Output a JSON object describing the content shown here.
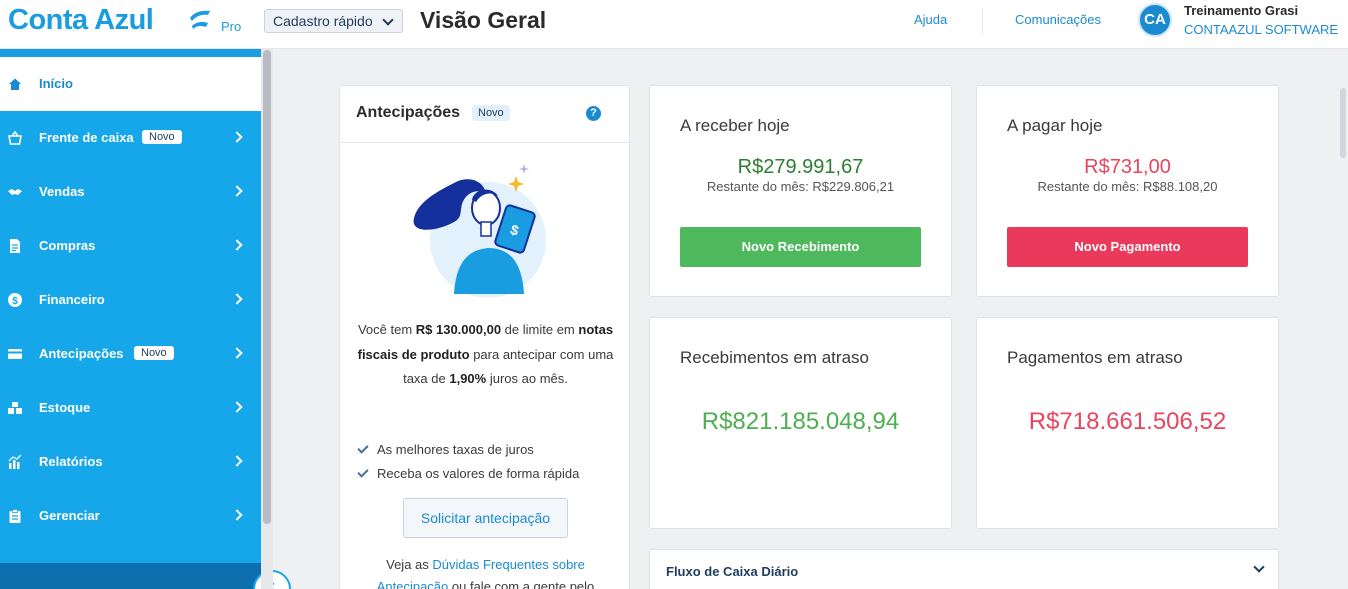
{
  "header": {
    "logo": "Conta Azul",
    "plan": "Pro",
    "quick_register": "Cadastro rápido",
    "page_title": "Visão Geral",
    "help": "Ajuda",
    "communications": "Comunicações",
    "avatar_initials": "CA",
    "user_name": "Treinamento Grasi",
    "company": "CONTAAZUL SOFTWARE"
  },
  "sidebar": {
    "items": [
      {
        "label": "Início",
        "icon": "home-icon",
        "active": true
      },
      {
        "label": "Frente de caixa",
        "icon": "basket-icon",
        "badge": "Novo"
      },
      {
        "label": "Vendas",
        "icon": "handshake-icon"
      },
      {
        "label": "Compras",
        "icon": "document-icon"
      },
      {
        "label": "Financeiro",
        "icon": "dollar-icon"
      },
      {
        "label": "Antecipações",
        "icon": "card-icon",
        "badge": "Novo"
      },
      {
        "label": "Estoque",
        "icon": "boxes-icon"
      },
      {
        "label": "Relatórios",
        "icon": "chart-icon"
      },
      {
        "label": "Gerenciar",
        "icon": "clipboard-icon"
      }
    ]
  },
  "antecipacoes": {
    "title": "Antecipações",
    "badge": "Novo",
    "text_1": "Você tem ",
    "limit": "R$ 130.000,00",
    "text_2": " de limite em ",
    "invoices": "notas fiscais de produto",
    "text_3": " para antecipar com uma taxa de ",
    "rate": "1,90%",
    "text_4": " juros ao mês.",
    "benefits": [
      "As melhores taxas de juros",
      "Receba os valores de forma rápida"
    ],
    "button": "Solicitar antecipação",
    "footer_1": "Veja as ",
    "footer_link": "Dúvidas Frequentes sobre Antecipação",
    "footer_2": " ou fale com a gente pelo"
  },
  "cards": {
    "receber": {
      "label": "A receber hoje",
      "value": "R$279.991,67",
      "sub": "Restante do mês: R$229.806,21",
      "button": "Novo Recebimento",
      "color": "#2e7d32",
      "button_color": "#4db85c"
    },
    "pagar": {
      "label": "A pagar hoje",
      "value": "R$731,00",
      "sub": "Restante do mês: R$88.108,20",
      "button": "Novo Pagamento",
      "color": "#e8455f",
      "button_color": "#e93a5c"
    },
    "receb_atraso": {
      "label": "Recebimentos em atraso",
      "value": "R$821.185.048,94",
      "color": "#4caf50"
    },
    "pag_atraso": {
      "label": "Pagamentos em atraso",
      "value": "R$718.661.506,52",
      "color": "#e8455f"
    }
  },
  "fluxo": {
    "title": "Fluxo de Caixa Diário"
  }
}
